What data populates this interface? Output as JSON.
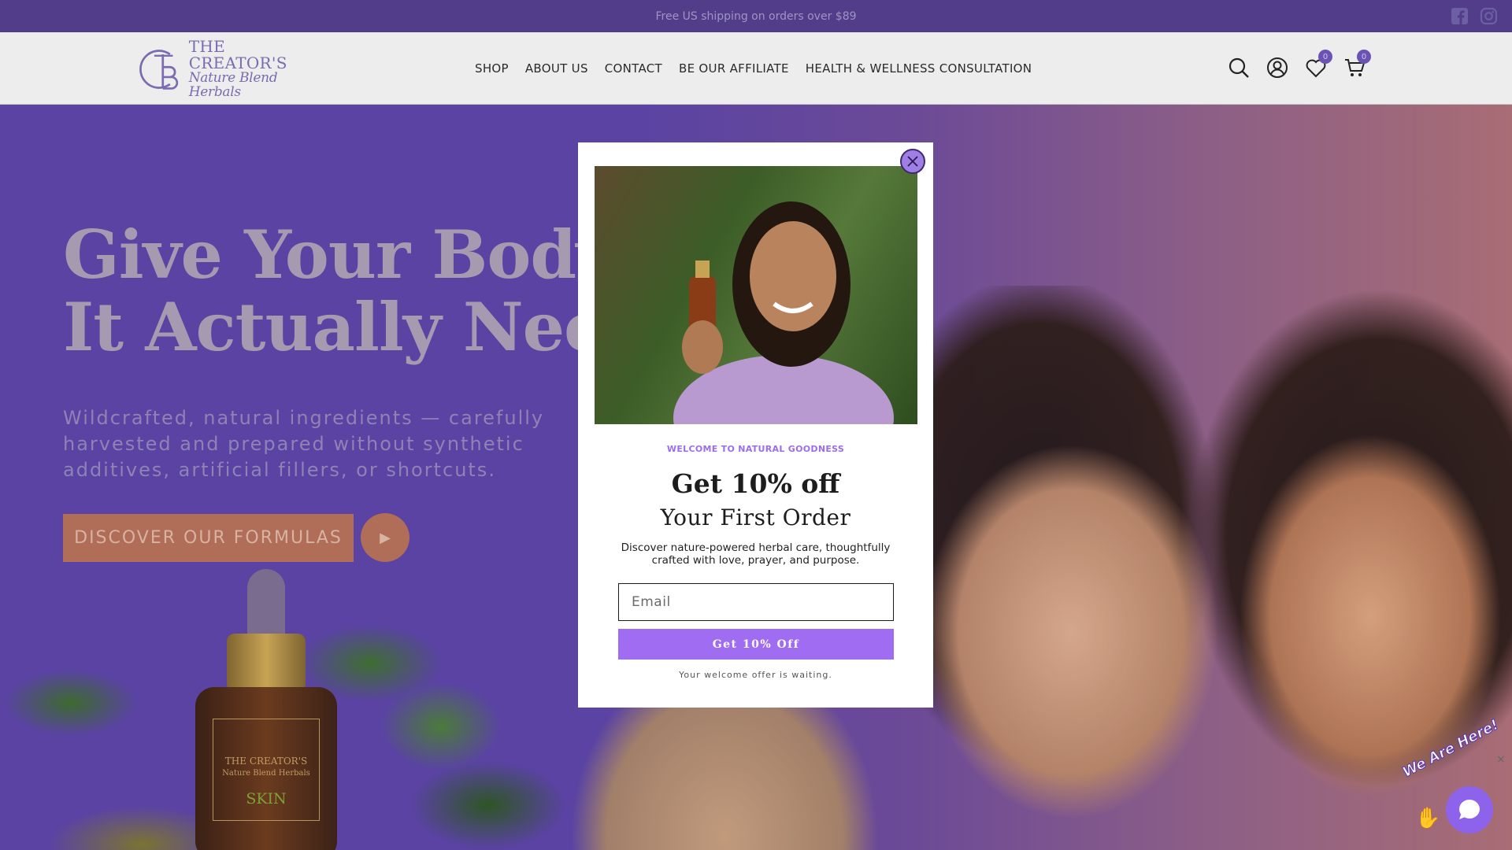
{
  "announcement": {
    "text": "Free US shipping on orders over $89"
  },
  "socials": [
    {
      "icon": "facebook-icon"
    },
    {
      "icon": "instagram-icon"
    }
  ],
  "logo": {
    "line1": "THE CREATOR'S",
    "line2": "Nature Blend Herbals"
  },
  "nav": {
    "items": [
      {
        "label": "SHOP"
      },
      {
        "label": "ABOUT US"
      },
      {
        "label": "CONTACT"
      },
      {
        "label": "BE OUR AFFILIATE"
      },
      {
        "label": "HEALTH & WELLNESS CONSULTATION"
      }
    ]
  },
  "header_icons": {
    "wishlist_count": "0",
    "cart_count": "0"
  },
  "hero": {
    "title_line1": "Give Your Body W",
    "title_line2": "It Actually Needs",
    "subtitle": "Wildcrafted, natural ingredients — carefully harvested and prepared without synthetic additives, artificial fillers, or shortcuts.",
    "cta_label": "DISCOVER OUR FORMULAS",
    "play_glyph": "▶",
    "bottle_brand": "THE CREATOR'S",
    "bottle_sub": "Nature Blend Herbals",
    "bottle_name": "SKIN"
  },
  "popup": {
    "eyebrow": "WELCOME TO NATURAL GOODNESS",
    "headline": "Get 10% off",
    "subheadline": "Your First Order",
    "description": "Discover nature-powered herbal care, thoughtfully crafted with love, prayer, and purpose.",
    "email_placeholder": "Email",
    "button_label": "Get 10% Off",
    "footnote": "Your welcome offer is waiting.",
    "accent_color": "#9f6cf2"
  },
  "chat": {
    "tag_text": "We Are Here!",
    "close_glyph": "×"
  },
  "colors": {
    "brand_purple": "#513d89",
    "hero_bg": "#5a43a3",
    "cta": "#b06d57"
  }
}
